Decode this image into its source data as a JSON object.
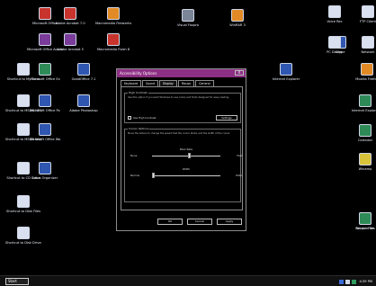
{
  "desktop_icons": [
    {
      "label": "Microsoft Office",
      "color": "g-red",
      "icon": "app-icon"
    },
    {
      "label": "Adobe Acrobat 7.0",
      "color": "g-red",
      "icon": "app-icon"
    },
    {
      "label": "Macromedia Fireworks 8",
      "color": "g-orange",
      "icon": "app-icon"
    },
    {
      "label": "Microsoft Office Access",
      "color": "g-purple",
      "icon": "app-icon"
    },
    {
      "label": "Adobe Acrobat 5",
      "color": "g-purple",
      "icon": "app-icon"
    },
    {
      "label": "Macromedia Flash 8",
      "color": "g-red",
      "icon": "app-icon"
    },
    {
      "label": "Shortcut to My Docs",
      "color": "g-white",
      "icon": "shortcut-icon"
    },
    {
      "label": "Microsoft Office Ex",
      "color": "g-green",
      "icon": "app-icon"
    },
    {
      "label": "GoodOffice 7.1",
      "color": "g-blue",
      "icon": "app-icon"
    },
    {
      "label": "Shortcut to MSDN NET",
      "color": "g-white",
      "icon": "shortcut-icon"
    },
    {
      "label": "Microsoft Office Po",
      "color": "g-blue",
      "icon": "app-icon"
    },
    {
      "label": "Adobe Photoshop",
      "color": "g-blue",
      "icon": "app-icon"
    },
    {
      "label": "Shortcut to MSDN Web",
      "color": "g-white",
      "icon": "shortcut-icon"
    },
    {
      "label": "Microsoft Office Wo",
      "color": "g-blue",
      "icon": "app-icon"
    },
    {
      "label": "Shortcut to CD Drive",
      "color": "g-white",
      "icon": "shortcut-icon"
    },
    {
      "label": "Lotus Organizer",
      "color": "g-blue",
      "icon": "app-icon"
    },
    {
      "label": "Shortcut to Disk Files",
      "color": "g-white",
      "icon": "shortcut-icon"
    },
    {
      "label": "Shortcut to Disk Drives",
      "color": "g-white",
      "icon": "shortcut-icon"
    },
    {
      "label": "Visual Foxpro",
      "color": "g-gray",
      "icon": "app-icon"
    },
    {
      "label": "WinRAR 3",
      "color": "g-orange",
      "icon": "app-icon"
    },
    {
      "label": "Internet Explorer",
      "color": "g-blue",
      "icon": "browser-icon"
    },
    {
      "label": "Skype",
      "color": "g-blue",
      "icon": "app-icon"
    },
    {
      "label": "Mozilla Firefox",
      "color": "g-orange",
      "icon": "browser-icon"
    },
    {
      "label": "Voice Rec",
      "color": "g-white",
      "icon": "app-icon"
    },
    {
      "label": "FTP Client",
      "color": "g-white",
      "icon": "app-icon"
    },
    {
      "label": "PC Doctor",
      "color": "g-white",
      "icon": "app-icon"
    },
    {
      "label": "Network",
      "color": "g-white",
      "icon": "app-icon"
    },
    {
      "label": "Internet Explorer",
      "color": "g-green",
      "icon": "app-icon"
    },
    {
      "label": "Calendar",
      "color": "g-green",
      "icon": "app-icon"
    },
    {
      "label": "Winamp",
      "color": "g-yellow",
      "icon": "app-icon"
    },
    {
      "label": "Recent Files",
      "color": "g-red",
      "icon": "app-icon"
    },
    {
      "label": "Recycle Bin",
      "color": "g-green",
      "icon": "recycle-bin-icon"
    }
  ],
  "dialog": {
    "title": "Accessibility Options",
    "close_label": "X",
    "tabs": [
      "Keyboard",
      "Sound",
      "Display",
      "Mouse",
      "General"
    ],
    "group1": {
      "title": "High Contrast",
      "description": "Use this option if you want Windows to use colors and fonts designed for easy reading.",
      "checkbox_label": "Use High Contrast",
      "settings_label": "Settings"
    },
    "group2": {
      "title": "Cursor Options",
      "description": "Move the sliders to change the speed that the cursor blinks and the width of the cursor.",
      "blink": {
        "title": "Blink Rate",
        "left": "None",
        "right": "Fast",
        "value": 0.55
      },
      "width": {
        "title": "Width",
        "left": "Narrow",
        "right": "Wide",
        "value": 0.02
      }
    },
    "buttons": {
      "ok": "OK",
      "cancel": "Cancel",
      "apply": "Apply"
    }
  },
  "taskbar": {
    "start_label": "Start",
    "clock": "4:39 PM"
  }
}
